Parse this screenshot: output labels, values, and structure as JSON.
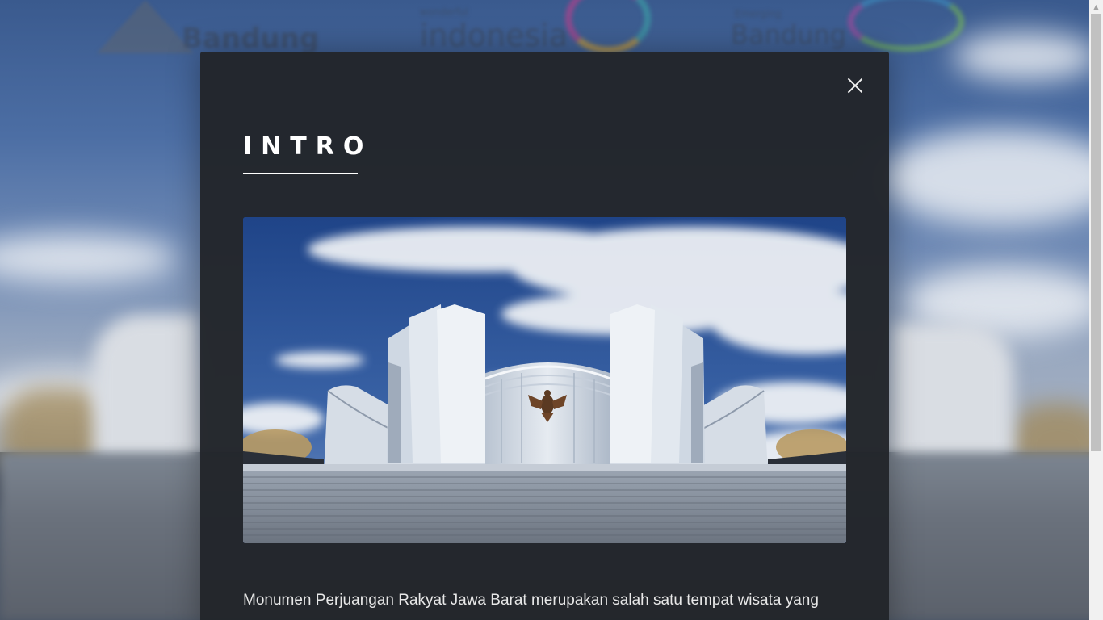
{
  "background": {
    "logos": [
      {
        "name": "mountain-logo-text",
        "text": "Bandung"
      },
      {
        "name": "wonderful-indonesia-logo",
        "small": "wonderful",
        "text": "indonesia"
      },
      {
        "name": "bandung-logo",
        "small": "Emerging",
        "text": "Bandung"
      }
    ]
  },
  "modal": {
    "title": "INTRO",
    "close_label": "×",
    "photo_alt": "Monumen Perjuangan Rakyat Jawa Barat",
    "intro_text": "Monumen Perjuangan Rakyat Jawa Barat merupakan salah satu tempat wisata yang"
  },
  "colors": {
    "modal_bg": "#22252a",
    "title": "#ffffff",
    "text": "#e8e8e8",
    "sky": "#2c4f8d"
  }
}
